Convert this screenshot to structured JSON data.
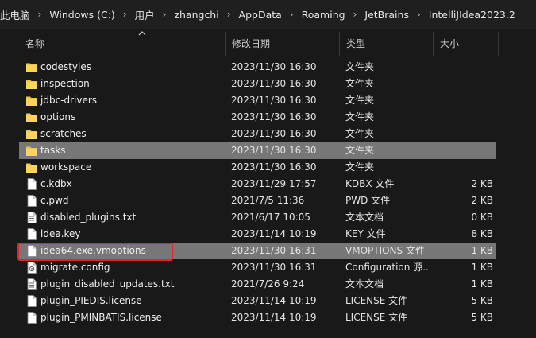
{
  "breadcrumb": [
    "此电脑",
    "Windows (C:)",
    "用户",
    "zhangchi",
    "AppData",
    "Roaming",
    "JetBrains",
    "IntelliJIdea2023.2"
  ],
  "columns": {
    "name": "名称",
    "date": "修改日期",
    "type": "类型",
    "size": "大小"
  },
  "sort": {
    "column": "name",
    "direction": "ascending"
  },
  "files": [
    {
      "name": "codestyles",
      "date": "2023/11/30 16:30",
      "type": "文件夹",
      "size": "",
      "icon": "folder-icon"
    },
    {
      "name": "inspection",
      "date": "2023/11/30 16:30",
      "type": "文件夹",
      "size": "",
      "icon": "folder-icon"
    },
    {
      "name": "jdbc-drivers",
      "date": "2023/11/30 16:30",
      "type": "文件夹",
      "size": "",
      "icon": "folder-icon"
    },
    {
      "name": "options",
      "date": "2023/11/30 16:30",
      "type": "文件夹",
      "size": "",
      "icon": "folder-icon"
    },
    {
      "name": "scratches",
      "date": "2023/11/30 16:30",
      "type": "文件夹",
      "size": "",
      "icon": "folder-icon"
    },
    {
      "name": "tasks",
      "date": "2023/11/30 16:30",
      "type": "文件夹",
      "size": "",
      "icon": "folder-icon"
    },
    {
      "name": "workspace",
      "date": "2023/11/30 16:30",
      "type": "文件夹",
      "size": "",
      "icon": "folder-icon"
    },
    {
      "name": "c.kdbx",
      "date": "2023/11/29 17:57",
      "type": "KDBX 文件",
      "size": "2 KB",
      "icon": "file-icon"
    },
    {
      "name": "c.pwd",
      "date": "2021/7/5 11:36",
      "type": "PWD 文件",
      "size": "2 KB",
      "icon": "file-icon"
    },
    {
      "name": "disabled_plugins.txt",
      "date": "2021/6/17 10:05",
      "type": "文本文档",
      "size": "0 KB",
      "icon": "text-file-icon"
    },
    {
      "name": "idea.key",
      "date": "2023/11/14 10:19",
      "type": "KEY 文件",
      "size": "8 KB",
      "icon": "file-icon"
    },
    {
      "name": "idea64.exe.vmoptions",
      "date": "2023/11/30 16:31",
      "type": "VMOPTIONS 文件",
      "size": "1 KB",
      "icon": "file-icon"
    },
    {
      "name": "migrate.config",
      "date": "2023/11/30 16:31",
      "type": "Configuration 源...",
      "size": "1 KB",
      "icon": "config-file-icon"
    },
    {
      "name": "plugin_disabled_updates.txt",
      "date": "2021/7/26 9:24",
      "type": "文本文档",
      "size": "1 KB",
      "icon": "text-file-icon"
    },
    {
      "name": "plugin_PIEDIS.license",
      "date": "2023/11/14 10:19",
      "type": "LICENSE 文件",
      "size": "5 KB",
      "icon": "file-icon"
    },
    {
      "name": "plugin_PMINBATIS.license",
      "date": "2023/11/14 10:19",
      "type": "LICENSE 文件",
      "size": "5 KB",
      "icon": "file-icon"
    }
  ],
  "selected_rows": [
    "tasks",
    "idea64.exe.vmoptions"
  ],
  "annotation": {
    "highlighted_item": "idea64.exe.vmoptions",
    "color": "#e0262a"
  },
  "colors": {
    "folder": "#f2c14e",
    "selection": "#777777",
    "background": "#191919"
  }
}
